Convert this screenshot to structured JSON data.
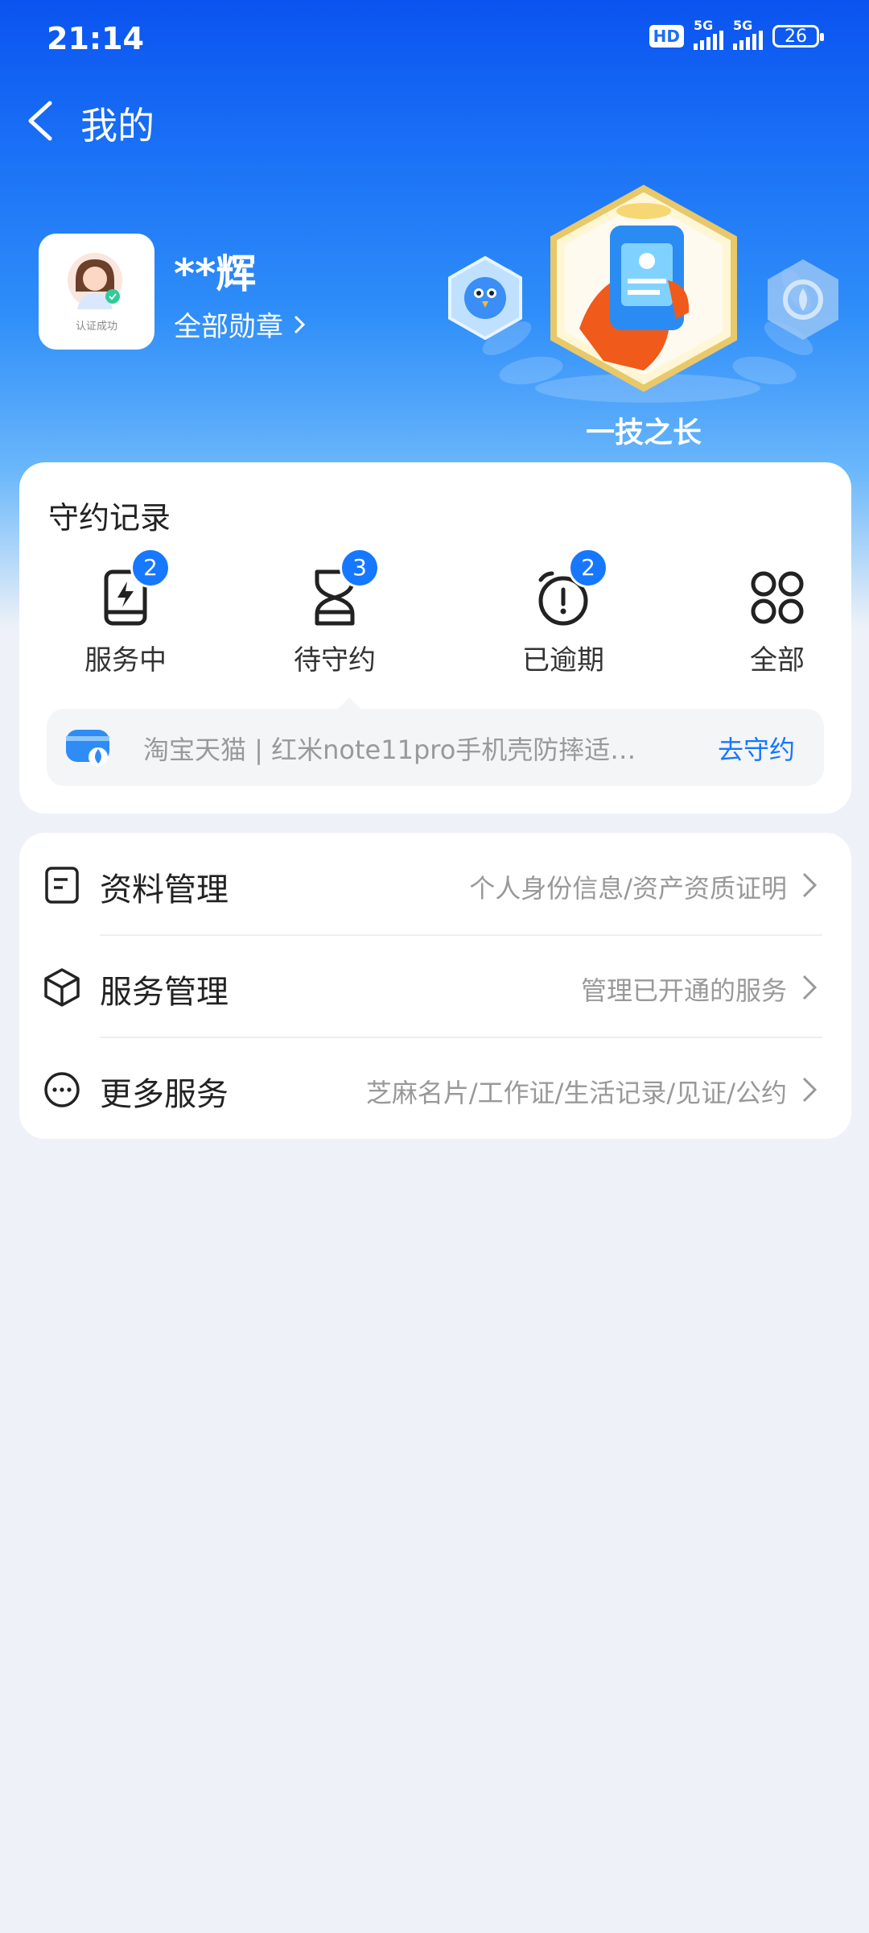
{
  "status_bar": {
    "time": "21:14",
    "hd_label": "HD",
    "net1": "5G",
    "net2": "5G",
    "battery": "26"
  },
  "nav": {
    "title": "我的"
  },
  "profile": {
    "avatar_caption": "认证成功",
    "name": "**辉",
    "all_medals_link": "全部勋章"
  },
  "medals": {
    "featured_name": "一技之长"
  },
  "records": {
    "title": "守约记录",
    "items": [
      {
        "label": "服务中",
        "badge": "2",
        "icon": "tablet-lightning-icon"
      },
      {
        "label": "待守约",
        "badge": "3",
        "icon": "hourglass-icon"
      },
      {
        "label": "已逾期",
        "badge": "2",
        "icon": "alarm-clock-icon"
      },
      {
        "label": "全部",
        "badge": "",
        "icon": "grid-icon"
      }
    ],
    "notice": {
      "text": "淘宝天猫 | 红米note11pro手机壳防摔适…",
      "action": "去守约"
    }
  },
  "menu": [
    {
      "label": "资料管理",
      "desc": "个人身份信息/资产资质证明",
      "icon": "document-icon"
    },
    {
      "label": "服务管理",
      "desc": "管理已开通的服务",
      "icon": "cube-icon"
    },
    {
      "label": "更多服务",
      "desc": "芝麻名片/工作证/生活记录/见证/公约",
      "icon": "more-dots-icon"
    }
  ],
  "colors": {
    "accent": "#1677ff",
    "hero_top": "#0a53f0",
    "page_bg": "#eef2f8"
  }
}
